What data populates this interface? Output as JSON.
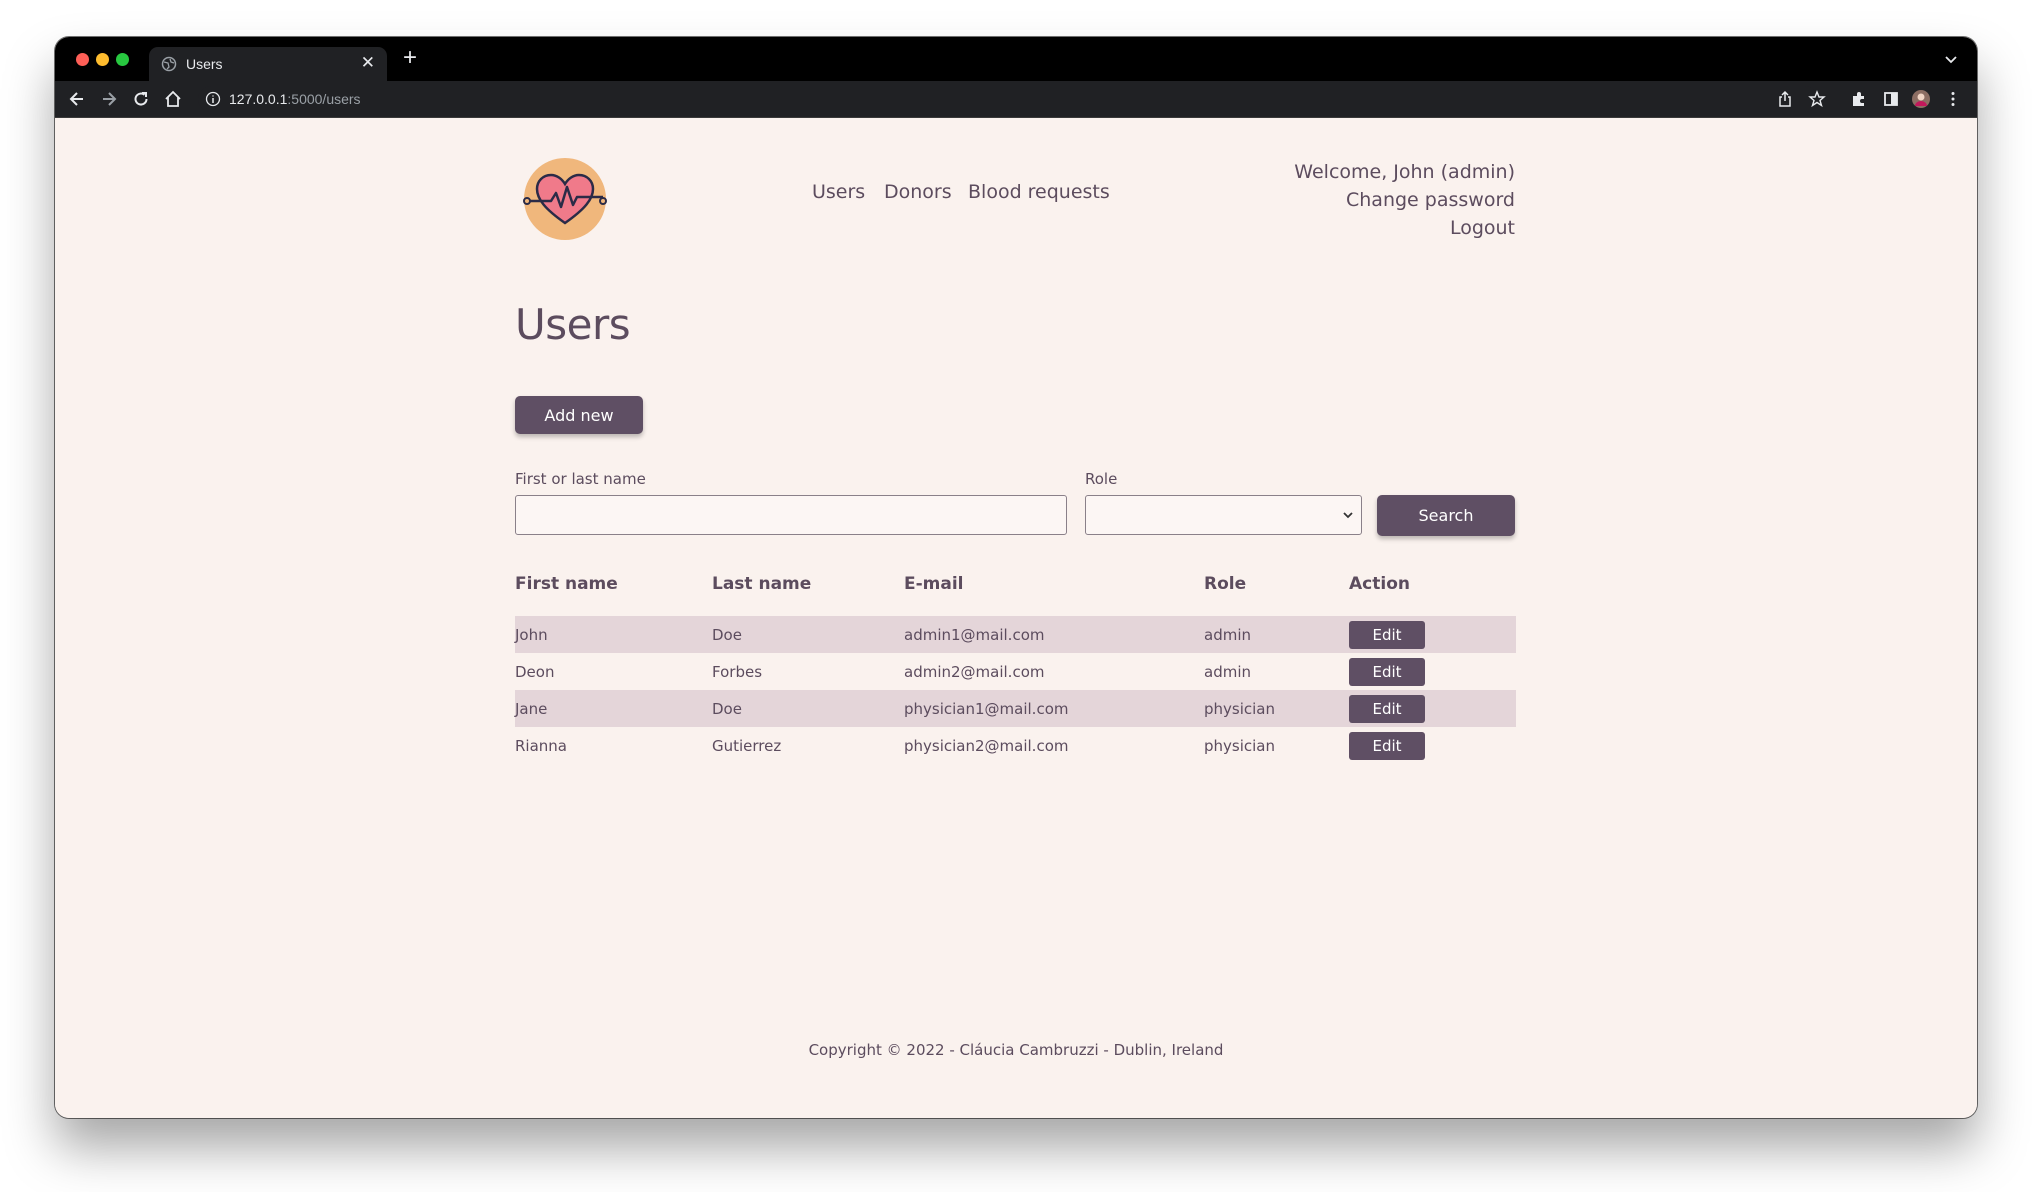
{
  "browser": {
    "tab_title": "Users",
    "tab_close": "✕",
    "new_tab": "+",
    "url_host": "127.0.0.1",
    "url_rest": ":5000/users",
    "icons": [
      "back-icon",
      "forward-icon",
      "reload-icon",
      "home-icon",
      "site-info-icon",
      "share-icon",
      "bookmark-star-icon",
      "extensions-icon",
      "side-panel-icon",
      "profile-avatar-icon",
      "menu-icon"
    ]
  },
  "header": {
    "nav": [
      "Users",
      "Donors",
      "Blood requests"
    ],
    "welcome": "Welcome, John (admin)",
    "change_password": "Change password",
    "logout": "Logout"
  },
  "main": {
    "title": "Users",
    "add_new": "Add new",
    "filter_name_label": "First or last name",
    "filter_name_value": "",
    "filter_role_label": "Role",
    "filter_role_value": "",
    "search": "Search"
  },
  "table": {
    "headers": [
      "First name",
      "Last name",
      "E-mail",
      "Role",
      "Action"
    ],
    "rows": [
      {
        "first": "John",
        "last": "Doe",
        "email": "admin1@mail.com",
        "role": "admin",
        "action": "Edit"
      },
      {
        "first": "Deon",
        "last": "Forbes",
        "email": "admin2@mail.com",
        "role": "admin",
        "action": "Edit"
      },
      {
        "first": "Jane",
        "last": "Doe",
        "email": "physician1@mail.com",
        "role": "physician",
        "action": "Edit"
      },
      {
        "first": "Rianna",
        "last": "Gutierrez",
        "email": "physician2@mail.com",
        "role": "physician",
        "action": "Edit"
      }
    ]
  },
  "footer": {
    "text": "Copyright © 2022 - Cláucia Cambruzzi - Dublin, Ireland"
  },
  "colors": {
    "page_bg": "#faf2ee",
    "primary": "#5f4f64",
    "row_stripe": "#e4d5d9",
    "logo_circle": "#f0b77c",
    "heart": "#f07a8a"
  }
}
